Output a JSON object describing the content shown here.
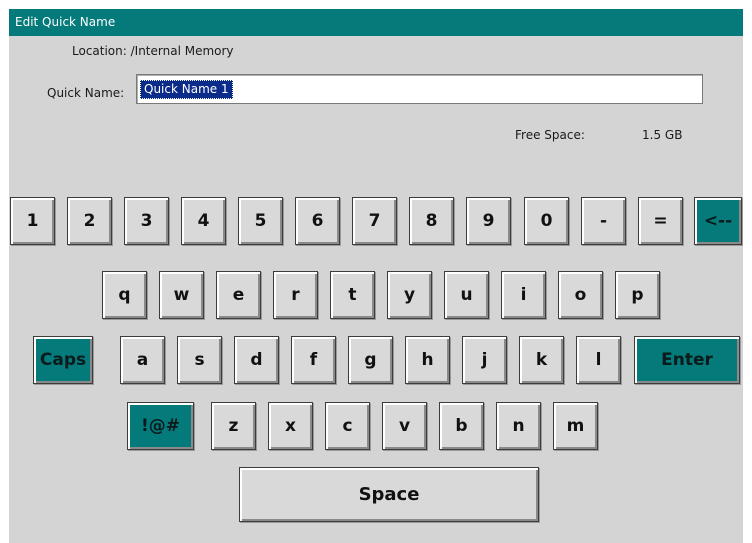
{
  "window": {
    "title": "Edit Quick Name"
  },
  "location": {
    "text": "Location: /Internal Memory"
  },
  "quick_name": {
    "label": "Quick Name:",
    "value": "Quick Name 1"
  },
  "free_space": {
    "label": "Free Space:",
    "value": "1.5 GB"
  },
  "colors": {
    "accent": "#047a7a",
    "background": "#d4d4d4",
    "selection": "#0b2b8a"
  },
  "keyboard": {
    "row1": [
      "1",
      "2",
      "3",
      "4",
      "5",
      "6",
      "7",
      "8",
      "9",
      "0",
      "-",
      "=",
      "<--"
    ],
    "row2": [
      "q",
      "w",
      "e",
      "r",
      "t",
      "y",
      "u",
      "i",
      "o",
      "p"
    ],
    "row3": [
      "Caps",
      "a",
      "s",
      "d",
      "f",
      "g",
      "h",
      "j",
      "k",
      "l",
      "Enter"
    ],
    "row4": [
      "!@#",
      "z",
      "x",
      "c",
      "v",
      "b",
      "n",
      "m"
    ],
    "space": "Space"
  }
}
